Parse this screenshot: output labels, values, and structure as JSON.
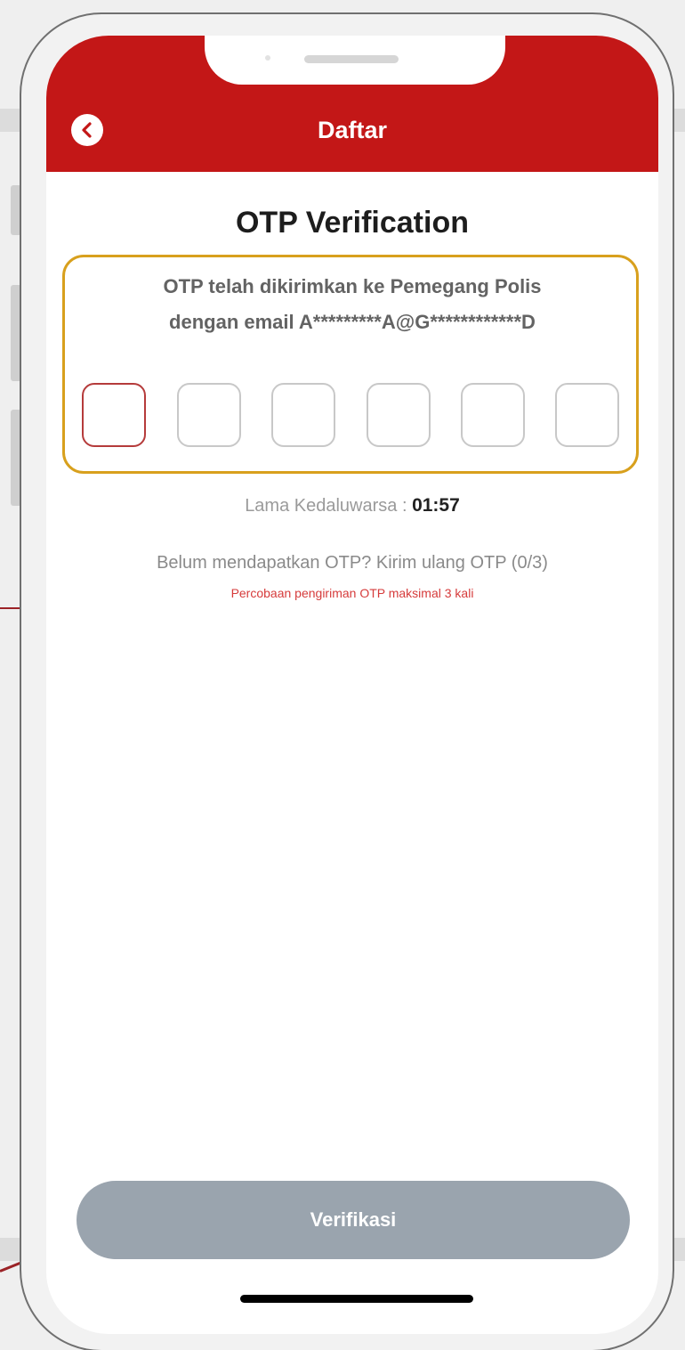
{
  "header": {
    "title": "Daftar",
    "back_icon": "chevron-left-icon"
  },
  "otp": {
    "heading": "OTP Verification",
    "message_line1": "OTP telah dikirimkan ke Pemegang Polis",
    "message_line2": "dengan email A*********A@G************D",
    "digits": [
      "",
      "",
      "",
      "",
      "",
      ""
    ]
  },
  "timer": {
    "label": "Lama Kedaluwarsa : ",
    "value": "01:57"
  },
  "resend": {
    "question": "Belum mendapatkan OTP? ",
    "link": "Kirim ulang OTP (0/3)",
    "warning": "Percobaan pengiriman OTP maksimal 3 kali"
  },
  "actions": {
    "verify_label": "Verifikasi"
  },
  "colors": {
    "primary": "#c31717",
    "highlight_border": "#d8a01d",
    "button_disabled": "#9aa4ae",
    "warning": "#d63b3b"
  }
}
